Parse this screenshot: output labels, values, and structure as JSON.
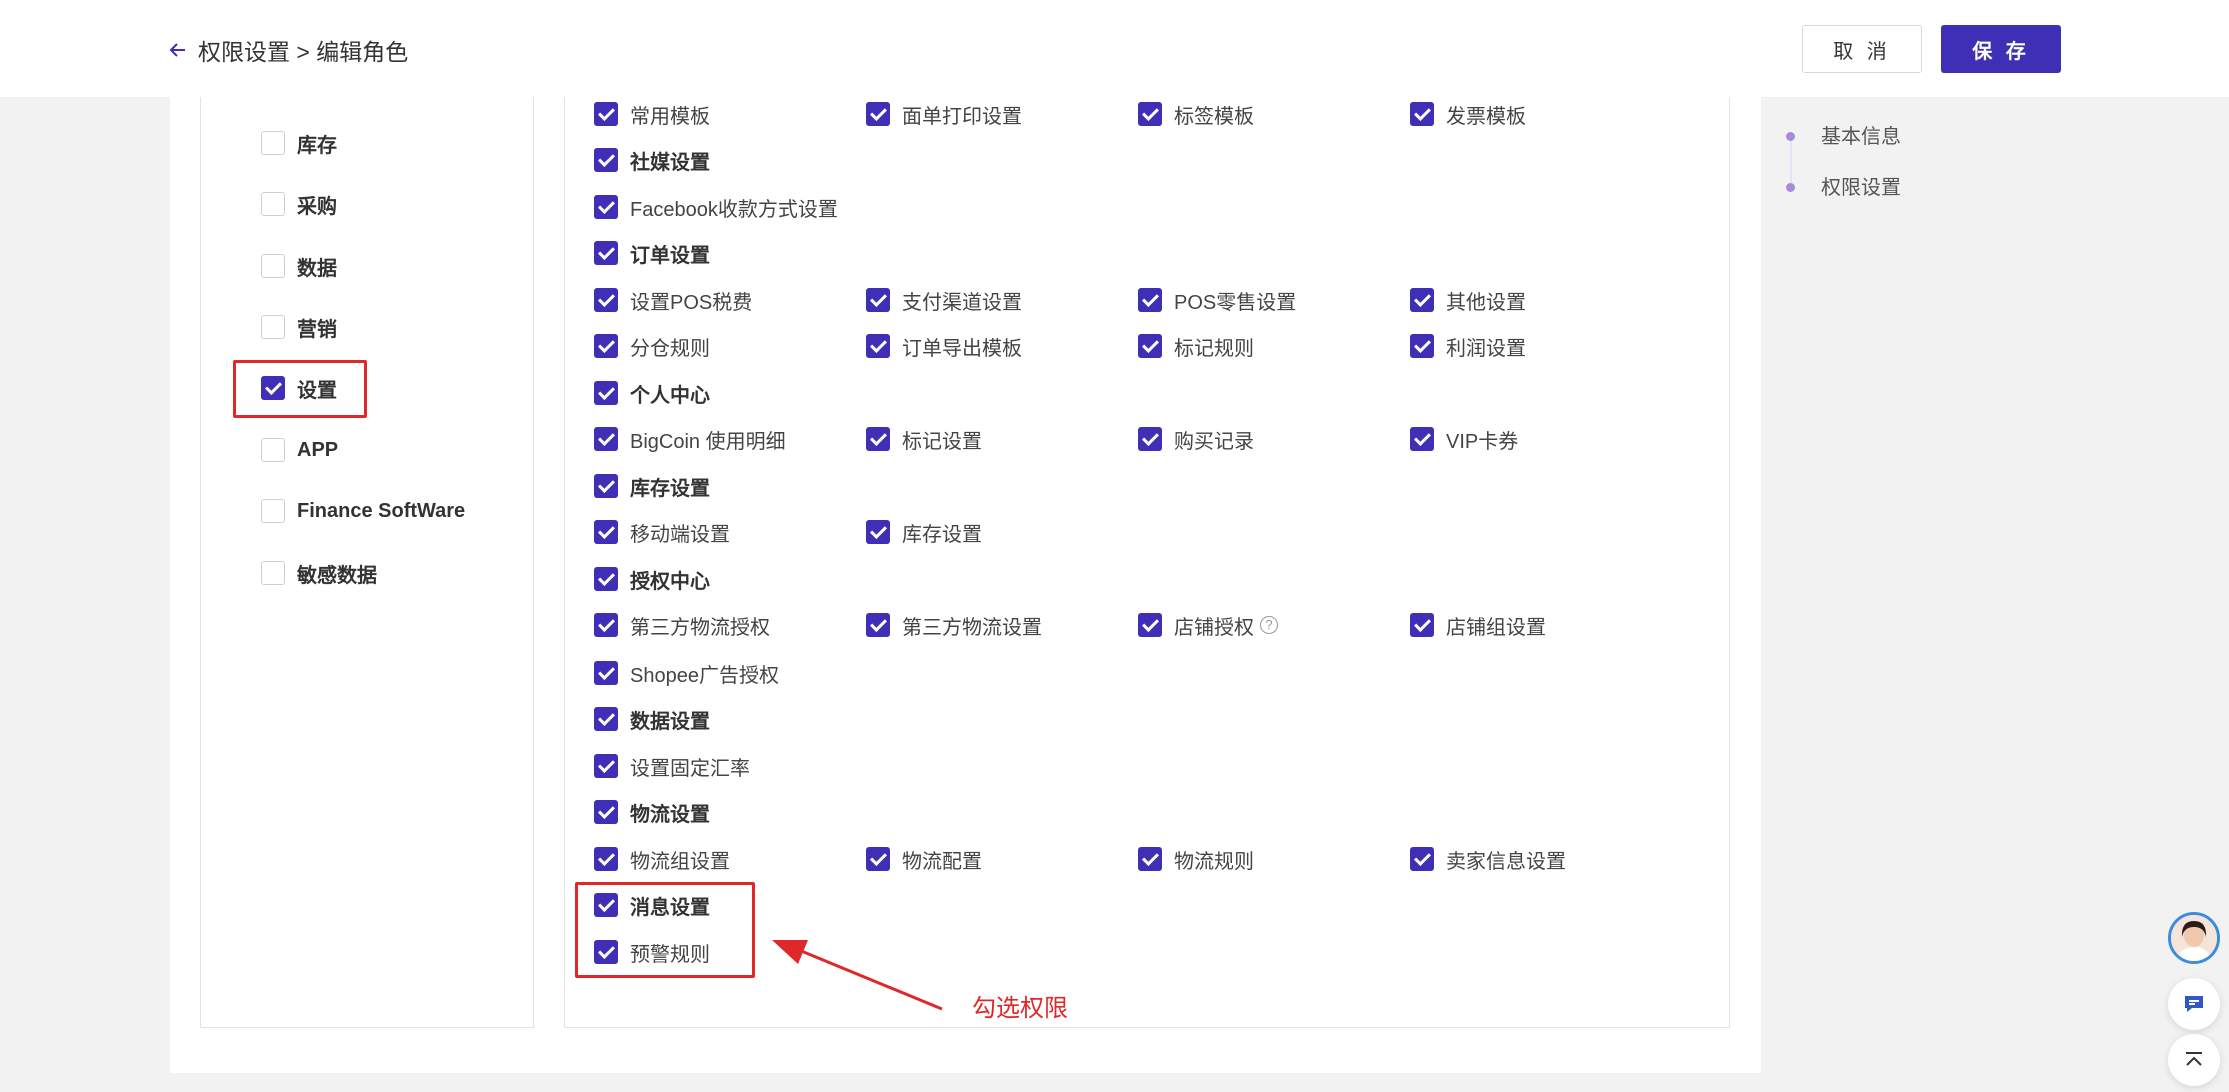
{
  "header": {
    "breadcrumb": "权限设置 > 编辑角色",
    "cancel_label": "取 消",
    "save_label": "保 存"
  },
  "categories": [
    {
      "label": "库存",
      "checked": false
    },
    {
      "label": "采购",
      "checked": false
    },
    {
      "label": "数据",
      "checked": false
    },
    {
      "label": "营销",
      "checked": false
    },
    {
      "label": "设置",
      "checked": true
    },
    {
      "label": "APP",
      "checked": false
    },
    {
      "label": "Finance SoftWare",
      "checked": false
    },
    {
      "label": "敏感数据",
      "checked": false
    }
  ],
  "permissions": {
    "row0": [
      "常用模板",
      "面单打印设置",
      "标签模板",
      "发票模板"
    ],
    "social_group": "社媒设置",
    "social": [
      "Facebook收款方式设置"
    ],
    "order_group": "订单设置",
    "order_row1": [
      "设置POS税费",
      "支付渠道设置",
      "POS零售设置",
      "其他设置"
    ],
    "order_row2": [
      "分仓规则",
      "订单导出模板",
      "标记规则",
      "利润设置"
    ],
    "personal_group": "个人中心",
    "personal": [
      "BigCoin 使用明细",
      "标记设置",
      "购买记录",
      "VIP卡券"
    ],
    "inventory_group": "库存设置",
    "inventory": [
      "移动端设置",
      "库存设置"
    ],
    "auth_group": "授权中心",
    "auth_row1": [
      "第三方物流授权",
      "第三方物流设置",
      "店铺授权",
      "店铺组设置"
    ],
    "auth_row2": [
      "Shopee广告授权"
    ],
    "data_group": "数据设置",
    "data": [
      "设置固定汇率"
    ],
    "logistics_group": "物流设置",
    "logistics": [
      "物流组设置",
      "物流配置",
      "物流规则",
      "卖家信息设置"
    ],
    "message_group": "消息设置",
    "message": [
      "预警规则"
    ]
  },
  "anchor_nav": [
    "基本信息",
    "权限设置"
  ],
  "annotation": "勾选权限",
  "colors": {
    "accent": "#3f2fb6",
    "annotation": "#e02828"
  },
  "icons": {
    "back": "arrow-left-icon",
    "help": "question-circle-icon",
    "chat": "chat-icon",
    "top": "back-to-top-icon"
  }
}
